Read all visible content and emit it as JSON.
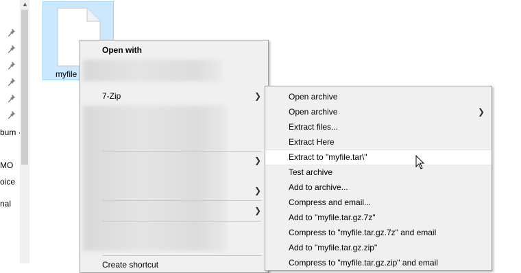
{
  "nav": {
    "items": [
      "bum ·",
      "MO",
      "oice",
      "nal"
    ]
  },
  "file": {
    "label": "myfile"
  },
  "main_menu": {
    "header": "Open with",
    "seven_zip": "7-Zip",
    "bottom_partial": "Create shortcut"
  },
  "submenu": {
    "items": [
      {
        "label": "Open archive",
        "has_arrow": false
      },
      {
        "label": "Open archive",
        "has_arrow": true
      },
      {
        "label": "Extract files...",
        "has_arrow": false
      },
      {
        "label": "Extract Here",
        "has_arrow": false
      },
      {
        "label": "Extract to \"myfile.tar\\\"",
        "has_arrow": false,
        "highlighted": true
      },
      {
        "label": "Test archive",
        "has_arrow": false
      },
      {
        "label": "Add to archive...",
        "has_arrow": false
      },
      {
        "label": "Compress and email...",
        "has_arrow": false
      },
      {
        "label": "Add to \"myfile.tar.gz.7z\"",
        "has_arrow": false
      },
      {
        "label": "Compress to \"myfile.tar.gz.7z\" and email",
        "has_arrow": false
      },
      {
        "label": "Add to \"myfile.tar.gz.zip\"",
        "has_arrow": false
      },
      {
        "label": "Compress to \"myfile.tar.gz.zip\" and email",
        "has_arrow": false
      }
    ]
  },
  "colors": {
    "selection_fill": "#cce8ff",
    "menu_bg": "#f0f0f0",
    "highlight": "#ffffff"
  }
}
